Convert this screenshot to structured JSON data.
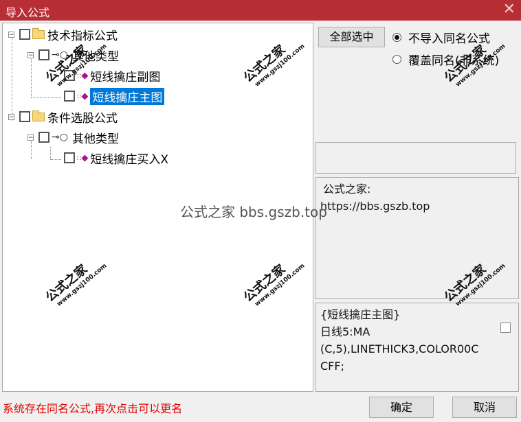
{
  "window": {
    "title": "导入公式",
    "close_glyph": "✕"
  },
  "tree": {
    "nodes": [
      {
        "label": "技术指标公式",
        "type": "folder"
      },
      {
        "label": "其他类型",
        "type": "key"
      },
      {
        "label": "短线擒庄副图",
        "type": "formula"
      },
      {
        "label": "短线擒庄主图",
        "type": "formula",
        "selected": true
      },
      {
        "label": "条件选股公式",
        "type": "folder"
      },
      {
        "label": "其他类型",
        "type": "key"
      },
      {
        "label": "短线擒庄买入X",
        "type": "formula"
      }
    ],
    "expander_glyph": "−"
  },
  "options": {
    "select_all_label": "全部选中",
    "radio_skip_label": "不导入同名公式",
    "radio_overwrite_label": "覆盖同名(非系统)",
    "selected_radio": "skip"
  },
  "info": {
    "site_name": "公式之家:",
    "site_url": "https://bbs.gszb.top"
  },
  "formula_preview": {
    "line1": "{短线擒庄主图}",
    "line2": "日线5:MA",
    "line3": "(C,5),LINETHICK3,COLOR00C",
    "line4": "CFF;"
  },
  "status_text": "系统存在同名公式,再次点击可以更名",
  "buttons": {
    "ok_label": "确定",
    "cancel_label": "取消"
  },
  "watermark": {
    "center_text": "公式之家 bbs.gszb.top",
    "stamp_title": "公式之家",
    "stamp_url": "www.gszj100.com"
  },
  "colors": {
    "titlebar": "#b72e35",
    "selection": "#0078d7",
    "status": "#e00000",
    "formula_icon": "#b0108e"
  }
}
